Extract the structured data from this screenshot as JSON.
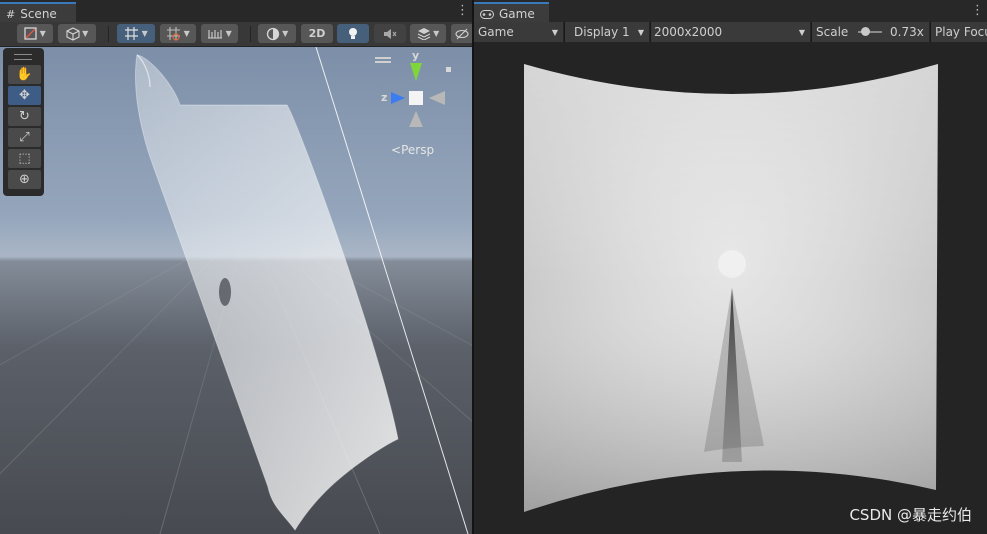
{
  "scene_panel": {
    "tab_label": "Scene",
    "view_2d_label": "2D",
    "gizmo": {
      "y_axis": "y",
      "z_axis": "z",
      "projection": "Persp"
    }
  },
  "game_panel": {
    "tab_label": "Game",
    "view_select": "Game",
    "display_select": "Display 1",
    "resolution_select": "2000x2000",
    "scale_label": "Scale",
    "scale_value": "0.73x",
    "play_focus_label": "Play Focu"
  },
  "watermark": "CSDN @暴走约伯",
  "colors": {
    "tab_accent": "#3a79bb",
    "toolbar_bg": "#383838",
    "active_button": "#46607c"
  }
}
